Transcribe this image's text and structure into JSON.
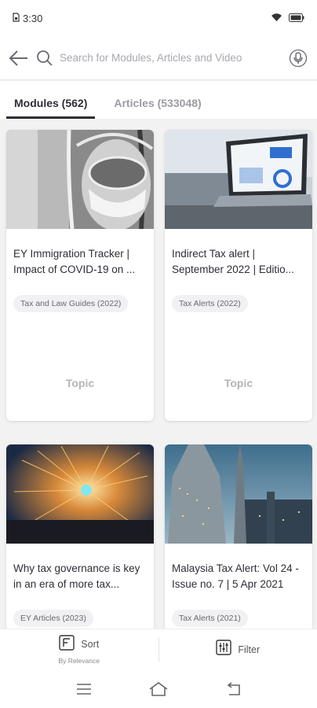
{
  "status": {
    "time": "3:30"
  },
  "search": {
    "placeholder": "Search for Modules, Articles and Video"
  },
  "tabs": [
    {
      "label": "Modules (562)",
      "active": true
    },
    {
      "label": "Articles (533048)",
      "active": false
    }
  ],
  "cards": [
    {
      "title": "EY Immigration Tracker | Impact of COVID-19 on ...",
      "tag": "Tax and Law Guides (2022)",
      "footer": "Topic",
      "image": "covid-ppe-photo"
    },
    {
      "title": "Indirect Tax alert  | September 2022 | Editio...",
      "tag": "Tax Alerts (2022)",
      "footer": "Topic",
      "image": "laptop-dashboard-photo"
    },
    {
      "title": "Why tax governance is key in an era of more tax...",
      "tag": "EY Articles (2023)",
      "footer": "",
      "image": "light-painting-photo"
    },
    {
      "title": "Malaysia Tax Alert: Vol 24 - Issue no. 7 | 5 Apr 2021",
      "tag": "Tax Alerts (2021)",
      "footer": "",
      "image": "kuala-lumpur-skyline-photo"
    }
  ],
  "bottom": {
    "sort_label": "Sort",
    "sort_sub": "By Relevance",
    "filter_label": "Filter"
  },
  "colors": {
    "text": "#2e2e38",
    "background": "#f2f2f2",
    "tag_bg": "#f1f1f3"
  }
}
